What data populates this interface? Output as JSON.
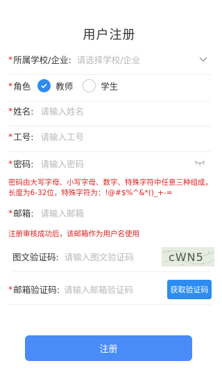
{
  "title": "用户注册",
  "school": {
    "required": "*",
    "label": "所属学校/企业:",
    "placeholder": "请选择学校/企业",
    "icon": "chevron-down-icon"
  },
  "role": {
    "required": "*",
    "label": "角色",
    "options": [
      {
        "label": "教师",
        "checked": true
      },
      {
        "label": "学生",
        "checked": false
      }
    ]
  },
  "name": {
    "required": "*",
    "label": "姓名:",
    "placeholder": "请输入姓名"
  },
  "job_no": {
    "required": "*",
    "label": "工号:",
    "placeholder": "请输入工号"
  },
  "password": {
    "required": "*",
    "label": "密码:",
    "placeholder": "请输入密码",
    "icon": "eye-closed-icon"
  },
  "password_hint": "密码由大写字母、小写字母、数字、特殊字符中任意三种组成，长度为6-32位，特殊字符为：!@#$%^&*()_+-=",
  "email": {
    "required": "*",
    "label": "邮箱:",
    "placeholder": "请输入邮箱"
  },
  "email_hint": "注册审核成功后，该邮箱作为用户名使用",
  "captcha": {
    "label": "图文验证码:",
    "placeholder": "请输入图文验证码",
    "image_text": "cWN5"
  },
  "email_code": {
    "required": "*",
    "label": "邮箱验证码:",
    "placeholder": "请输入邮箱验证码",
    "button": "获取验证码"
  },
  "submit": "注册",
  "colors": {
    "primary": "#2d8cf0",
    "button": "#4a8cf7",
    "required": "#e02020",
    "placeholder": "#b8b8b8"
  }
}
